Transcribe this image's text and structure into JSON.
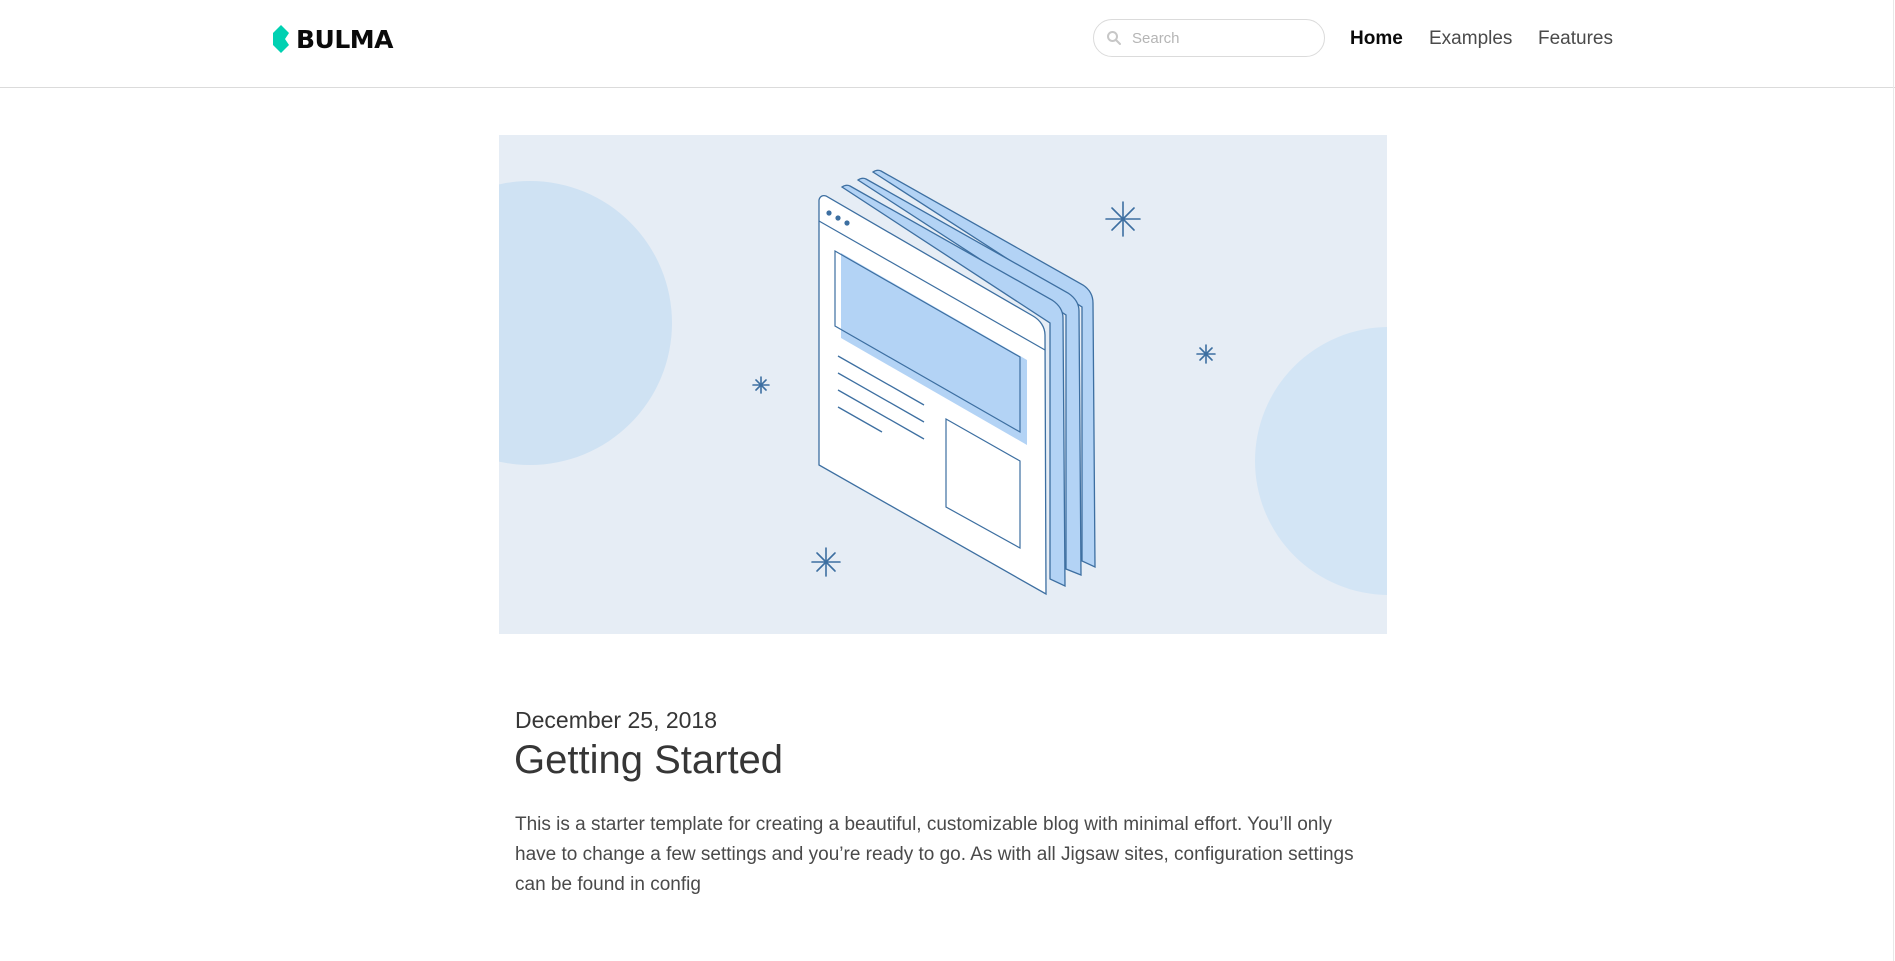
{
  "navbar": {
    "brand": "BULMA",
    "brand_icon": "bulma-logo-icon",
    "brand_color": "#00d1b2",
    "search_placeholder": "Search",
    "search_value": "",
    "links": [
      {
        "label": "Home",
        "active": true
      },
      {
        "label": "Examples",
        "active": false
      },
      {
        "label": "Features",
        "active": false
      }
    ]
  },
  "hero": {
    "background": "#e6edf5",
    "accent": "#b3d3f5",
    "stroke": "#3d6fa1",
    "illustration": "isometric-browser-windows-illustration"
  },
  "post": {
    "date": "December 25, 2018",
    "title": "Getting Started",
    "excerpt": "This is a starter template for creating a beautiful, customizable blog with minimal effort. You’ll only have to change a few settings and you’re ready to go. As with all Jigsaw sites, configuration settings can be found in config"
  }
}
